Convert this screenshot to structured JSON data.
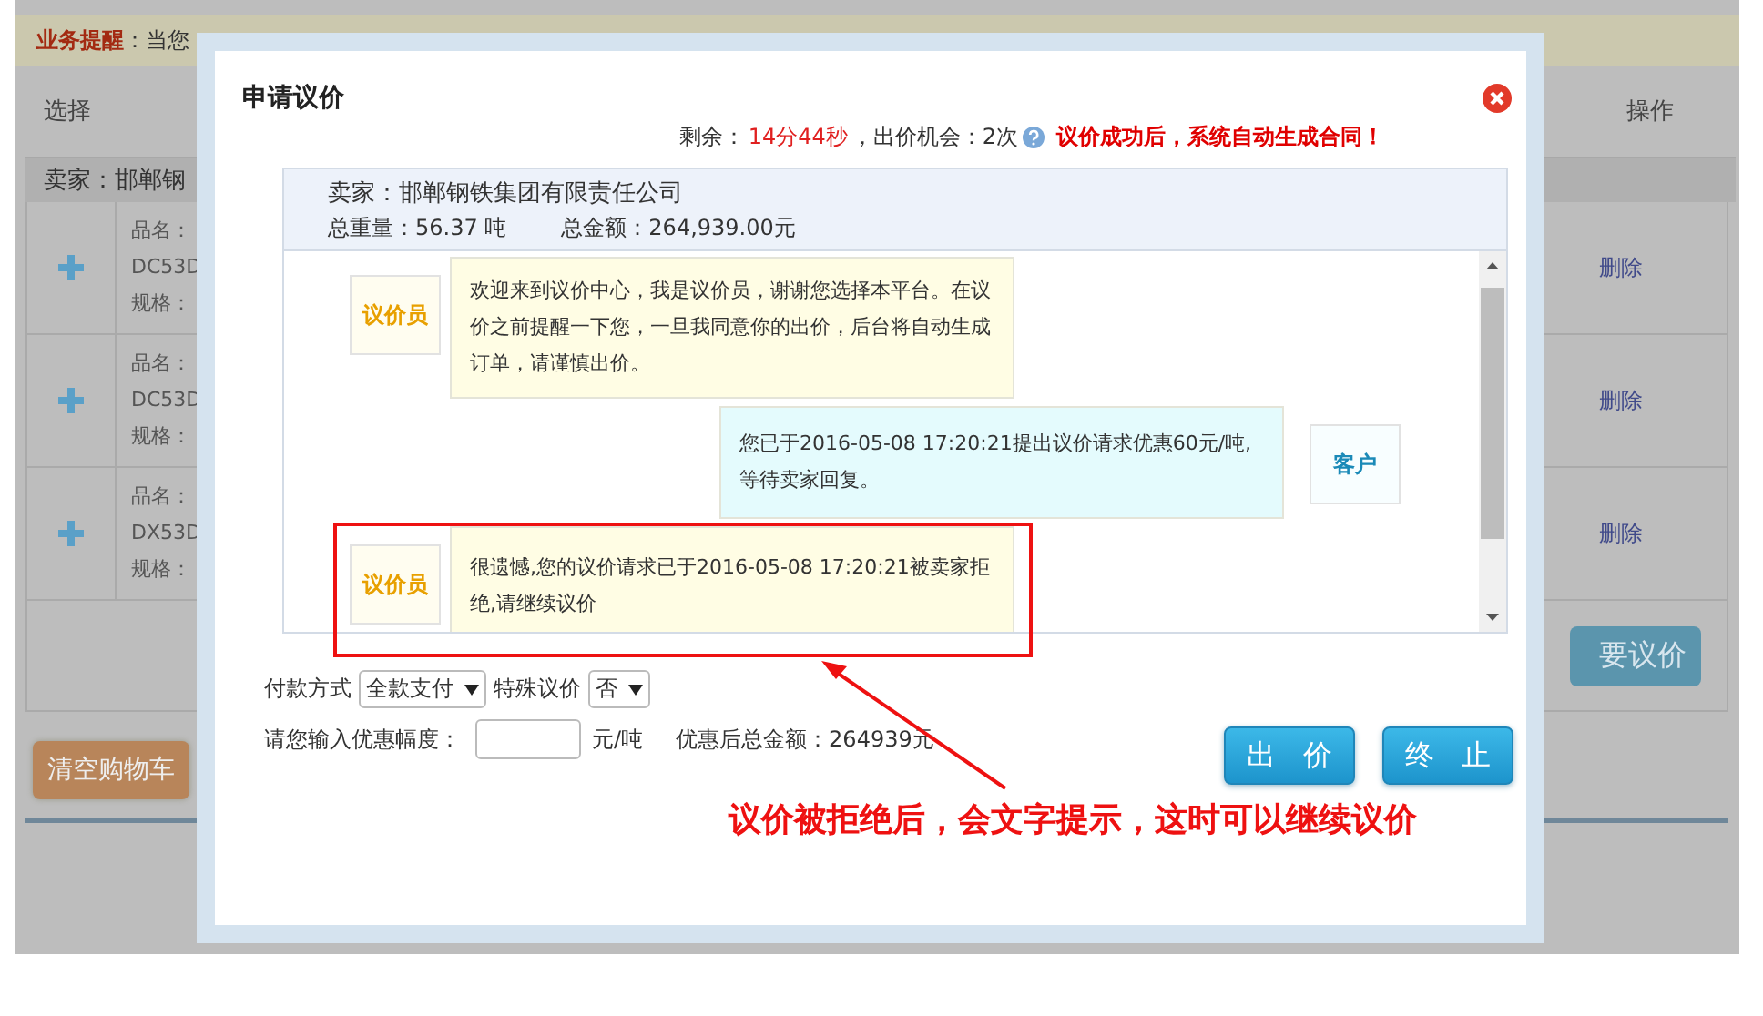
{
  "notice": {
    "label": "业务提醒",
    "text": "：当您"
  },
  "table": {
    "columns": [
      "选择",
      "操作"
    ],
    "group": "卖家：邯郸钢",
    "rows": [
      {
        "lines": [
          "品名：",
          "DC53D",
          "规格："
        ],
        "action": "删除"
      },
      {
        "lines": [
          "品名：",
          "DC53D",
          "规格："
        ],
        "action": "删除"
      },
      {
        "lines": [
          "品名：",
          "DX53D",
          "规格："
        ],
        "action": "删除"
      }
    ]
  },
  "negotiate_button": "要议价",
  "clear_button": "清空购物车",
  "dialog": {
    "title": "申请议价",
    "status": {
      "remaining_label": "剩余：",
      "remaining": "14分44秒",
      "chances": "，出价机会：2次",
      "notice": "议价成功后，系统自动生成合同！"
    },
    "seller": "卖家：邯郸钢铁集团有限责任公司",
    "weight": "总重量：56.37 吨",
    "total": "总金额：264,939.00元",
    "messages": [
      {
        "kind": "agent",
        "sender": "议价员",
        "text": "欢迎来到议价中心，我是议价员，谢谢您选择本平台。在议价之前提醒一下您，一旦我同意你的出价，后台将自动生成订单，请谨慎出价。"
      },
      {
        "kind": "customer",
        "sender": "客户",
        "text": "您已于2016-05-08 17:20:21提出议价请求优惠60元/吨,等待卖家回复。"
      },
      {
        "kind": "agent",
        "sender": "议价员",
        "text": "很遗憾,您的议价请求已于2016-05-08 17:20:21被卖家拒绝,请继续议价"
      }
    ],
    "payment": {
      "label": "付款方式",
      "value": "全款支付"
    },
    "special": {
      "label": "特殊议价",
      "value": "否"
    },
    "discount": {
      "label": "请您输入优惠幅度：",
      "unit": "元/吨",
      "total": "优惠后总金额：264939元"
    },
    "buttons": [
      "出 价",
      "终 止"
    ]
  },
  "annotation": "议价被拒绝后，会文字提示，这时可以继续议价"
}
